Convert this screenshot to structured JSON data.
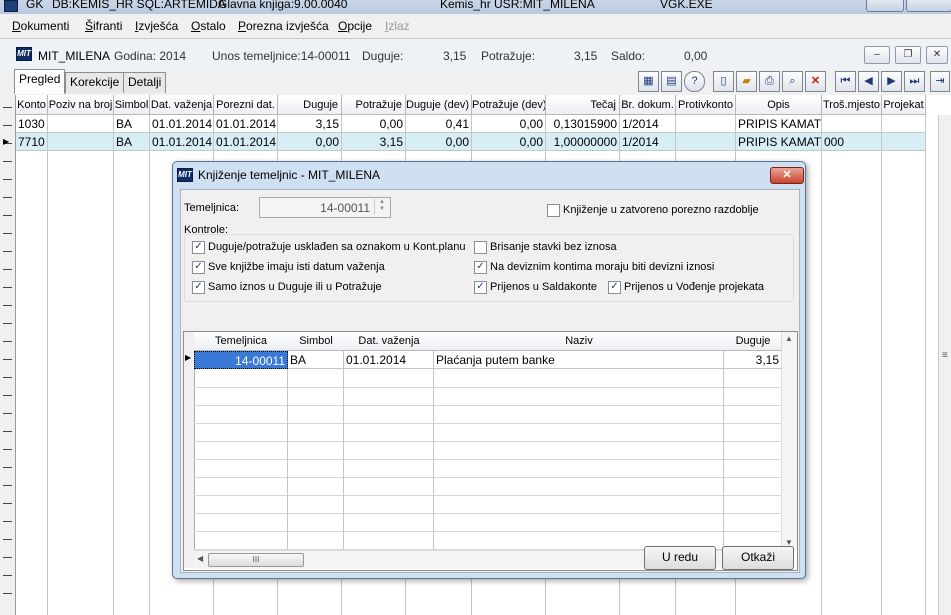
{
  "titlebar": {
    "app": "GK",
    "db": "DB:KEMIS_HR SQL:ARTEMIDA",
    "glavna": "Glavna knjiga:9.00.0040",
    "user": "Kemis_hr USR:MIT_MILENA",
    "exe": "VGK.EXE"
  },
  "menu": {
    "items": [
      "Dokumenti",
      "Šifranti",
      "Izvješća",
      "Ostalo",
      "Porezna izvješća",
      "Opcije",
      "Izlaz"
    ]
  },
  "child": {
    "title": "MIT_MILENA",
    "godina": "Godina: 2014",
    "unos": "Unos temeljnice:14-00011",
    "duguje_label": "Duguje:",
    "duguje_value": "3,15",
    "potrazuje_label": "Potražuje:",
    "potrazuje_value": "3,15",
    "saldo_label": "Saldo:",
    "saldo_value": "0,00"
  },
  "tabs": [
    "Pregled",
    "Korekcije",
    "Detalji"
  ],
  "grid": {
    "headers": [
      "Konto",
      "Poziv na broj",
      "Simbol",
      "Dat. važenja",
      "Porezni dat.",
      "Duguje",
      "Potražuje",
      "Duguje (dev)",
      "Potražuje (dev)",
      "Tečaj",
      "Br. dokum.",
      "Protivkonto",
      "Opis",
      "Troš.mjesto",
      "Projekat"
    ],
    "rows": [
      [
        "1030",
        "",
        "BA",
        "01.01.2014",
        "01.01.2014",
        "3,15",
        "0,00",
        "0,41",
        "0,00",
        "0,13015900",
        "1/2014",
        "",
        "PRIPIS KAMATE",
        "",
        ""
      ],
      [
        "7710",
        "",
        "BA",
        "01.01.2014",
        "01.01.2014",
        "0,00",
        "3,15",
        "0,00",
        "0,00",
        "1,00000000",
        "1/2014",
        "",
        "PRIPIS KAMATE",
        "000",
        ""
      ]
    ]
  },
  "dialog": {
    "title": "Knjiženje temeljnic - MIT_MILENA",
    "temeljnica_label": "Temeljnica:",
    "temeljnica_value": "14-00011",
    "zatvoreno_label": "Knjiženje u zatvoreno porezno razdoblje",
    "kontrole_label": "Kontrole:",
    "checks": [
      {
        "label": "Duguje/potražuje usklađen sa oznakom u Kont.planu",
        "checked": true
      },
      {
        "label": "Brisanje stavki bez iznosa",
        "checked": false
      },
      {
        "label": "Sve knjižbe imaju isti datum važenja",
        "checked": true
      },
      {
        "label": "Na deviznim kontima moraju biti devizni iznosi",
        "checked": true
      },
      {
        "label": "Samo iznos u Duguje ili u Potražuje",
        "checked": true
      },
      {
        "label": "Prijenos u Saldakonte",
        "checked": true
      },
      {
        "label": "Prijenos u Vođenje projekata",
        "checked": true
      }
    ],
    "grid": {
      "headers": [
        "Temeljnica",
        "Simbol",
        "Dat. važenja",
        "Naziv",
        "Duguje"
      ],
      "row": [
        "14-00011",
        "BA",
        "01.01.2014",
        "Plaćanja putem banke",
        "3,15"
      ]
    },
    "scroll_thumb": "III",
    "ok": "U redu",
    "cancel": "Otkaži"
  }
}
